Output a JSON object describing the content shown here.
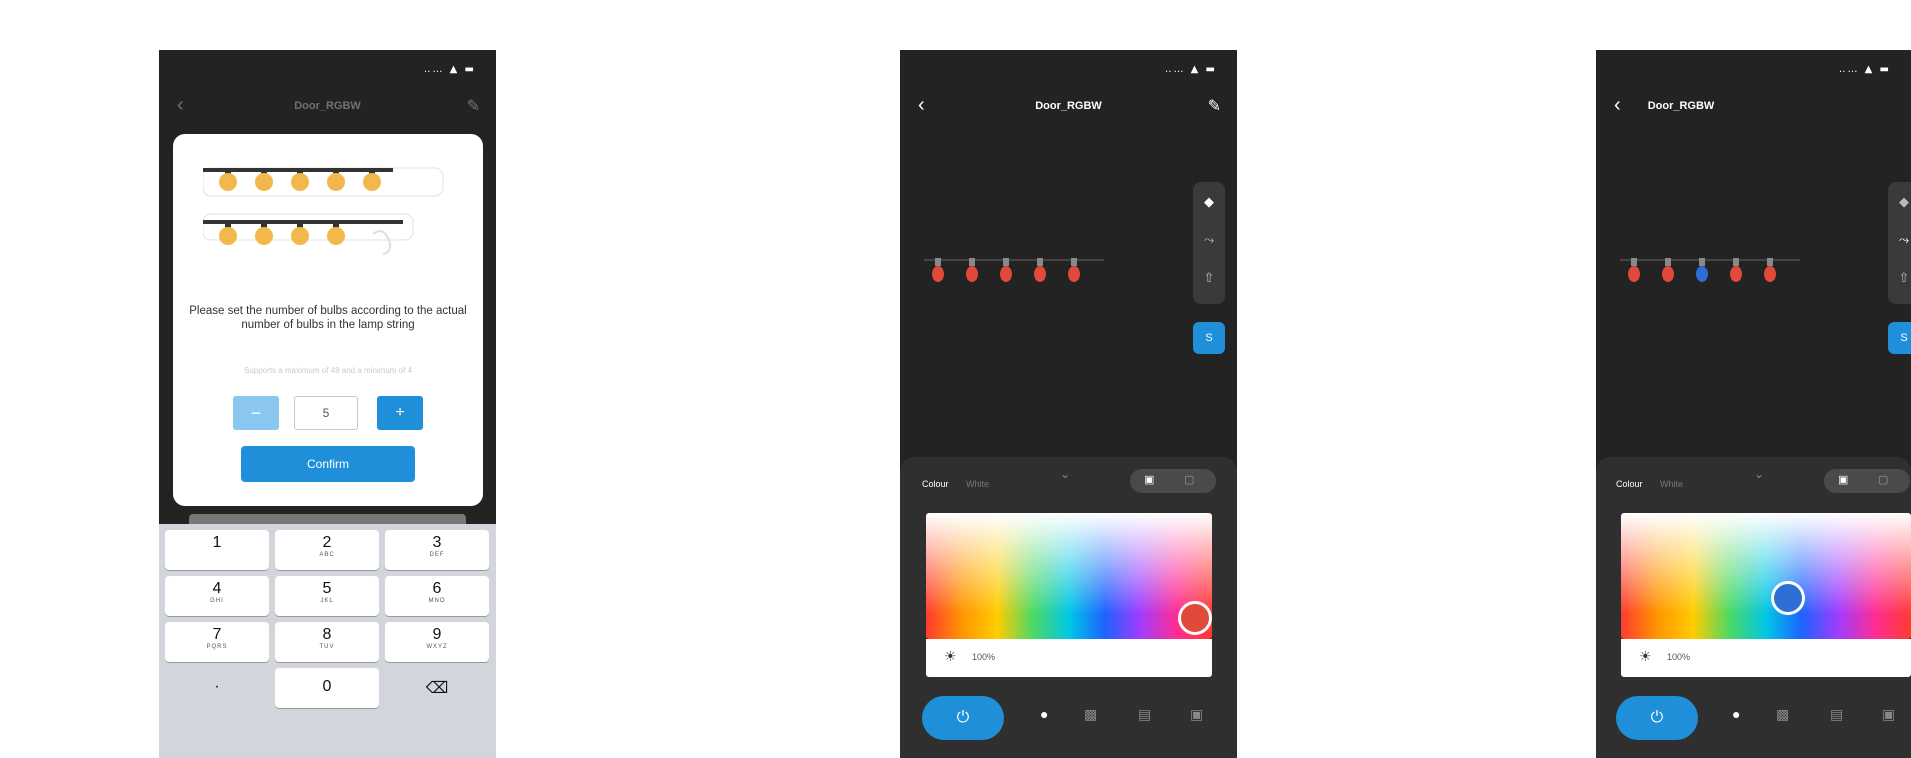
{
  "screen1": {
    "status": "‥… ▲ ▬",
    "nav": {
      "back": "‹",
      "title": "Door_RGBW",
      "edit": "✎"
    },
    "dialog": {
      "message": "Please set the number of bulbs according to the actual number of bulbs in the lamp string",
      "hint": "Supports a maximum of 48 and a minimum of 4",
      "minus": "−",
      "value": "5",
      "plus": "+",
      "confirm": "Confirm"
    },
    "keypad": [
      {
        "digit": "1",
        "letters": ""
      },
      {
        "digit": "2",
        "letters": "ABC"
      },
      {
        "digit": "3",
        "letters": "DEF"
      },
      {
        "digit": "4",
        "letters": "GHI"
      },
      {
        "digit": "5",
        "letters": "JKL"
      },
      {
        "digit": "6",
        "letters": "MNO"
      },
      {
        "digit": "7",
        "letters": "PQRS"
      },
      {
        "digit": "8",
        "letters": "TUV"
      },
      {
        "digit": "9",
        "letters": "WXYZ"
      },
      {
        "digit": "·",
        "letters": ""
      },
      {
        "digit": "0",
        "letters": ""
      },
      {
        "digit": "⌫",
        "letters": ""
      }
    ]
  },
  "screen2": {
    "status": "‥… ▲ ▬",
    "nav": {
      "back": "‹",
      "title": "Door_RGBW",
      "edit": "✎"
    },
    "tools": [
      "◆",
      "⤳",
      "⇧"
    ],
    "segment_button": "S",
    "tabs": {
      "colour": "Colour",
      "white": "White"
    },
    "collapse": "⌄",
    "brightness": "100%",
    "bulb_colors": [
      "#e04a3a",
      "#e04a3a",
      "#e04a3a",
      "#e04a3a",
      "#e04a3a"
    ],
    "selected_color": "#e04a3a",
    "power_icon": "⏻",
    "nav_icons": [
      "●",
      "▩",
      "▤",
      "▣"
    ]
  },
  "screen3": {
    "status": "‥… ▲ ▬",
    "nav": {
      "back": "‹",
      "title": "Door_RGBW"
    },
    "tools": [
      "◆",
      "⤳",
      "⇧"
    ],
    "segment_button": "S",
    "tabs": {
      "colour": "Colour",
      "white": "White"
    },
    "collapse": "⌄",
    "brightness": "100%",
    "bulb_colors": [
      "#e04a3a",
      "#e04a3a",
      "#2d6fd6",
      "#e04a3a",
      "#e04a3a"
    ],
    "selected_color": "#2d6fd6",
    "power_icon": "⏻",
    "nav_icons": [
      "●",
      "▩",
      "▤",
      "▣"
    ]
  }
}
